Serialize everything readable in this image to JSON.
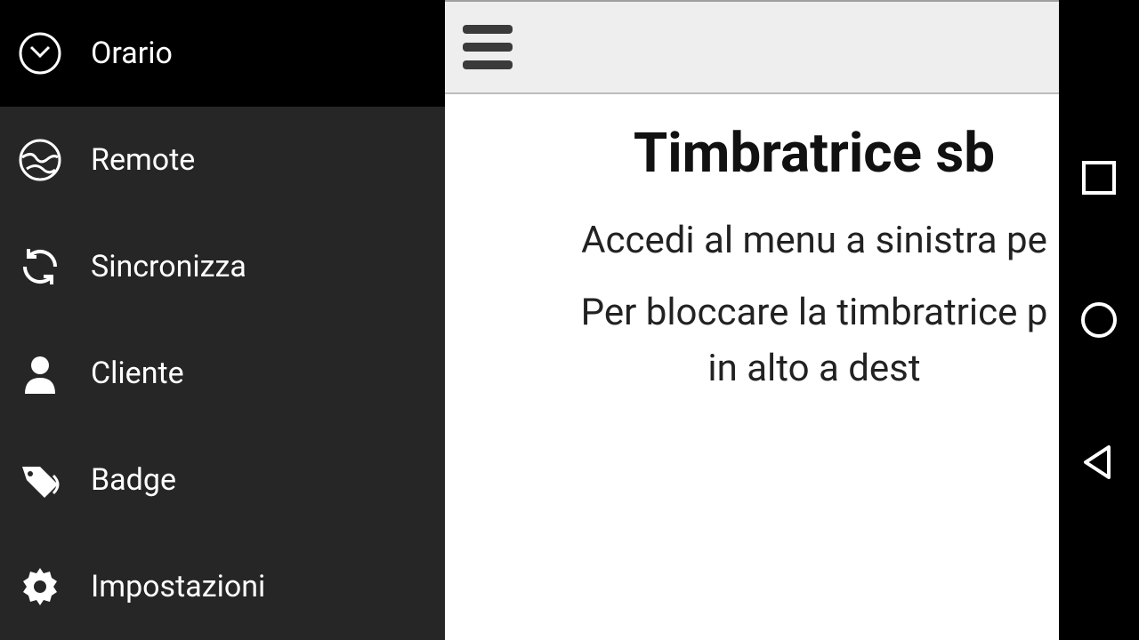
{
  "sidebar": {
    "items": [
      {
        "label": "Orario",
        "icon": "clock-icon",
        "active": true
      },
      {
        "label": "Remote",
        "icon": "globe-icon",
        "active": false
      },
      {
        "label": "Sincronizza",
        "icon": "sync-icon",
        "active": false
      },
      {
        "label": "Cliente",
        "icon": "person-icon",
        "active": false
      },
      {
        "label": "Badge",
        "icon": "tag-icon",
        "active": false
      },
      {
        "label": "Impostazioni",
        "icon": "gear-icon",
        "active": false
      }
    ]
  },
  "main": {
    "title": "Timbratrice sb",
    "line1": "Accedi al menu a sinistra pe",
    "line2": "Per bloccare la timbratrice p",
    "line3": "in alto a dest"
  }
}
